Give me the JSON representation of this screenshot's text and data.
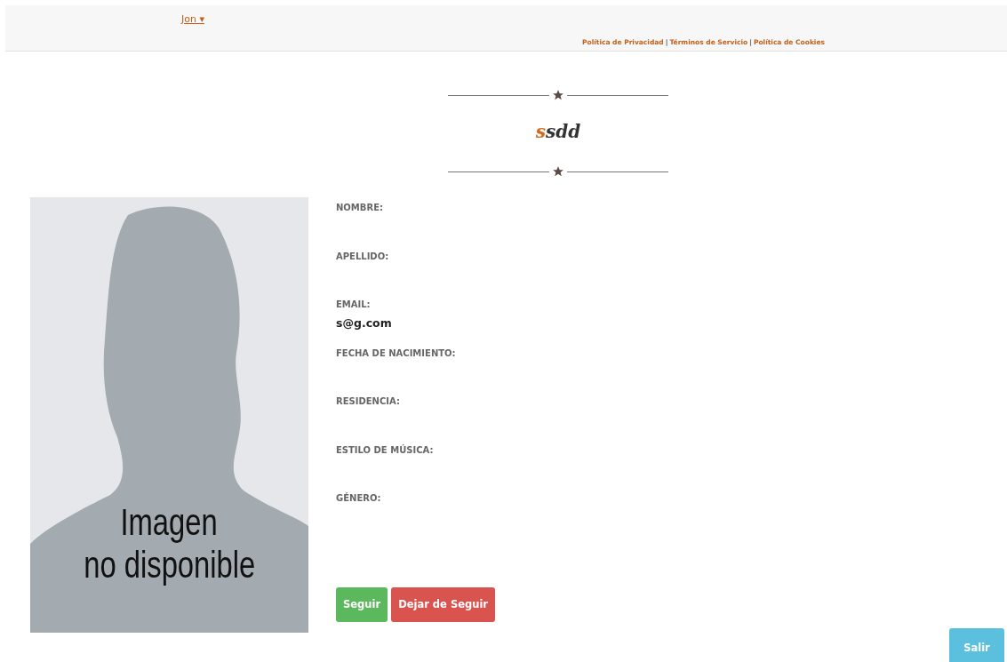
{
  "header": {
    "user_menu": {
      "label": "Jon",
      "caret": "▾"
    },
    "links": [
      {
        "label": "Política de Privacidad"
      },
      {
        "label": "Términos de Servicio"
      },
      {
        "label": "Política de Cookies"
      }
    ],
    "separator": "|"
  },
  "profile": {
    "username_initial": "s",
    "username_rest": "sdd",
    "image_placeholder": {
      "lines": [
        "Imagen",
        "no disponible"
      ]
    },
    "fields": [
      {
        "label": "NOMBRE:"
      },
      {
        "label": "APELLIDO:"
      },
      {
        "label": "EMAIL:",
        "value": "s@g.com"
      },
      {
        "label": "FECHA DE NACIMIENTO:"
      },
      {
        "label": "RESIDENCIA:"
      },
      {
        "label": "ESTILO DE MÚSICA:"
      },
      {
        "label": "GÉNERO:"
      }
    ],
    "buttons": [
      {
        "label": "Seguir",
        "kind": "success"
      },
      {
        "label": "Dejar de Seguir",
        "kind": "danger"
      }
    ]
  },
  "logout_button": {
    "label": "Salir"
  }
}
